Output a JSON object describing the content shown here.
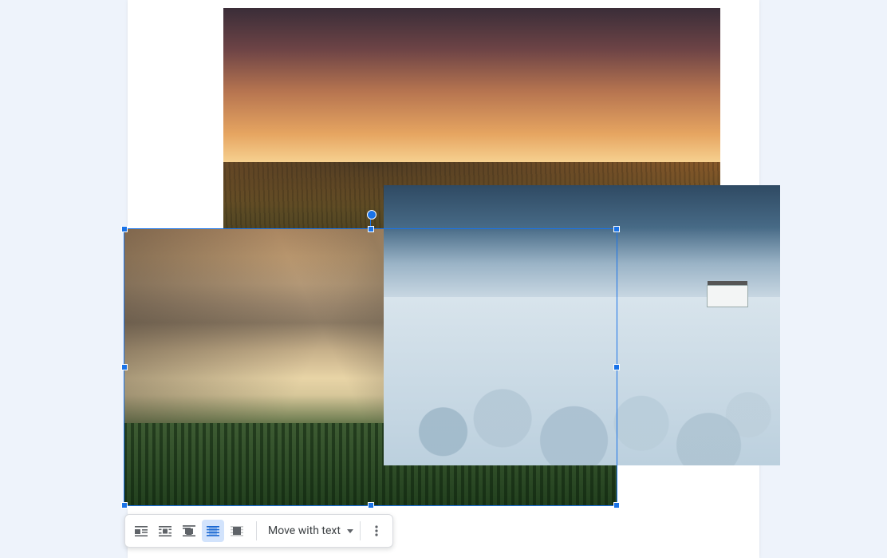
{
  "document": {
    "images": [
      {
        "name": "sunset-vineyard-image",
        "z": 1
      },
      {
        "name": "winter-landscape-image",
        "z": 3
      },
      {
        "name": "misty-mountains-image",
        "z": 2,
        "selected": true
      }
    ]
  },
  "toolbar": {
    "wrap_options": [
      {
        "name": "in-line",
        "active": false
      },
      {
        "name": "wrap-text",
        "active": false
      },
      {
        "name": "break-text",
        "active": false
      },
      {
        "name": "behind-text",
        "active": true
      },
      {
        "name": "in-front-of-text",
        "active": false
      }
    ],
    "move_label": "Move with text",
    "more_label": "More image options"
  }
}
